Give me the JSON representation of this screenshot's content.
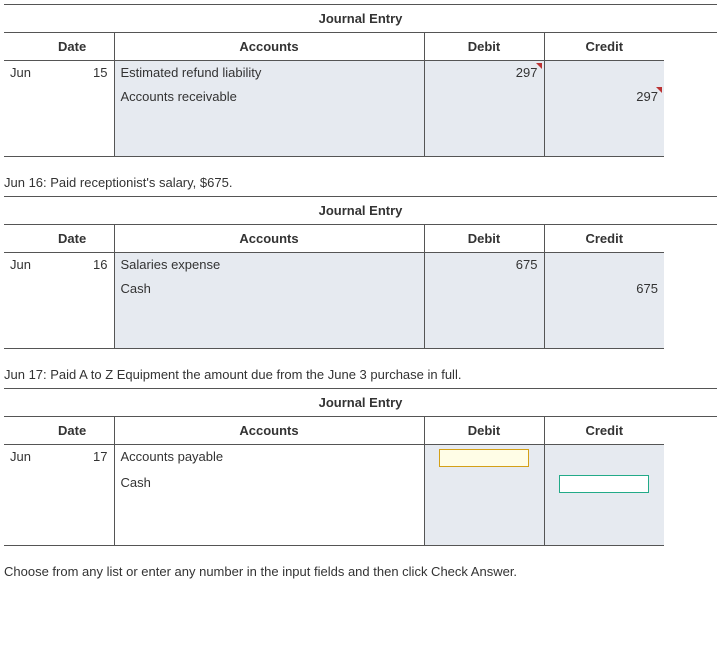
{
  "headers": {
    "journal_title": "Journal Entry",
    "date": "Date",
    "accounts": "Accounts",
    "debit": "Debit",
    "credit": "Credit"
  },
  "entries": [
    {
      "narration": null,
      "month": "Jun",
      "day": "15",
      "rows": [
        {
          "account": "Estimated refund liability",
          "debit": "297",
          "credit": "",
          "indent": false,
          "flag_debit": true,
          "flag_credit": false
        },
        {
          "account": "Accounts receivable",
          "debit": "",
          "credit": "297",
          "indent": true,
          "flag_debit": false,
          "flag_credit": true
        }
      ]
    },
    {
      "narration": "Jun 16: Paid receptionist's salary, $675.",
      "month": "Jun",
      "day": "16",
      "rows": [
        {
          "account": "Salaries expense",
          "debit": "675",
          "credit": "",
          "indent": false,
          "flag_debit": false,
          "flag_credit": false
        },
        {
          "account": "Cash",
          "debit": "",
          "credit": "675",
          "indent": true,
          "flag_debit": false,
          "flag_credit": false
        }
      ]
    },
    {
      "narration": "Jun 17: Paid A to Z Equipment the amount due from the June 3 purchase in full.",
      "month": "Jun",
      "day": "17",
      "rows": [
        {
          "account": "Accounts payable",
          "debit_input": "active-yellow",
          "credit": "",
          "indent": false
        },
        {
          "account": "Cash",
          "debit": "",
          "credit_input": "active-blue",
          "indent": false
        }
      ],
      "white_accounts": true
    }
  ],
  "footer": "Choose from any list or enter any number in the input fields and then click Check Answer."
}
